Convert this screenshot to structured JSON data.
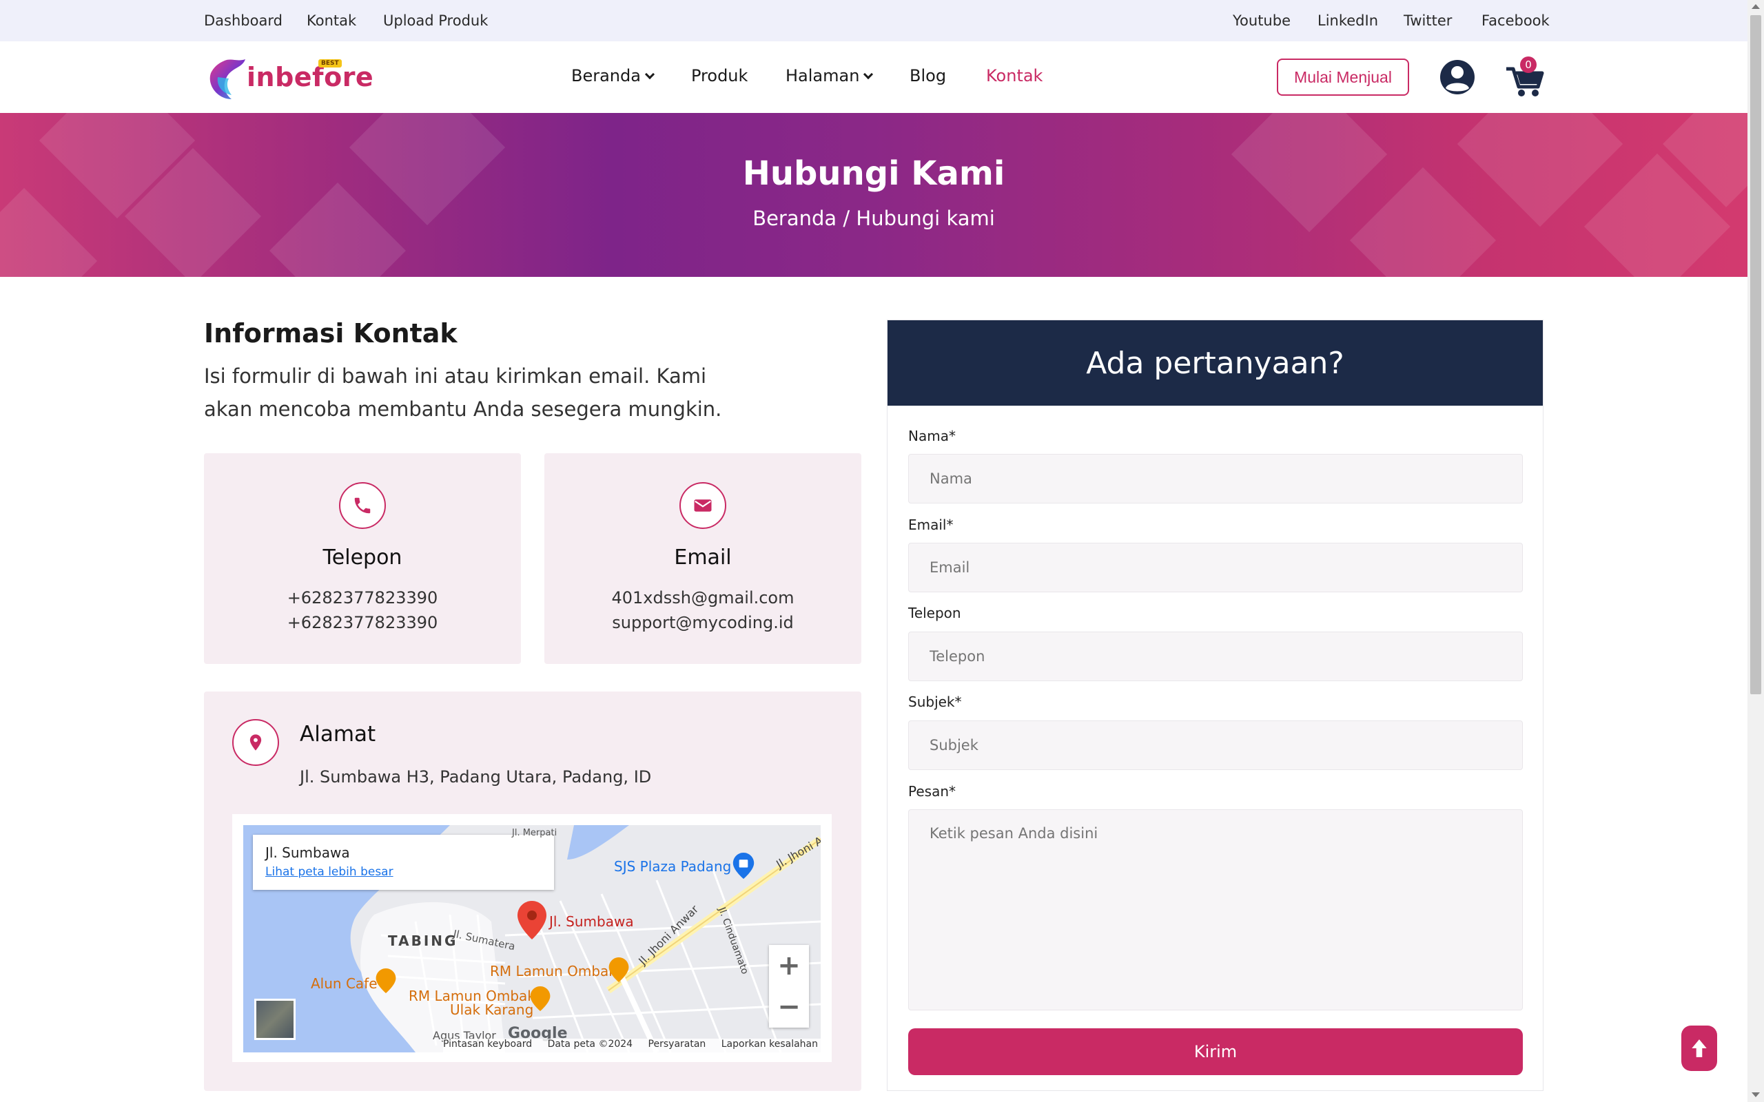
{
  "topbar": {
    "left_links": [
      "Dashboard",
      "Kontak",
      "Upload Produk"
    ],
    "right_links": [
      "Youtube",
      "LinkedIn",
      "Twitter",
      "Facebook"
    ]
  },
  "header": {
    "logo_text": "inbefore",
    "logo_badge": "BEST",
    "nav": {
      "beranda": "Beranda",
      "produk": "Produk",
      "halaman": "Halaman",
      "blog": "Blog",
      "kontak": "Kontak"
    },
    "sell_button": "Mulai Menjual",
    "cart_count": "0",
    "accent_color": "#c92a64"
  },
  "banner": {
    "title": "Hubungi Kami",
    "breadcrumb_home": "Beranda",
    "breadcrumb_sep": "/",
    "breadcrumb_current": "Hubungi kami"
  },
  "info": {
    "title": "Informasi Kontak",
    "description": "Isi formulir di bawah ini atau kirimkan email. Kami akan mencoba membantu Anda sesegera mungkin.",
    "phone": {
      "title": "Telepon",
      "lines": [
        "+6282377823390",
        "+6282377823390"
      ]
    },
    "email": {
      "title": "Email",
      "lines": [
        "401xdssh@gmail.com",
        "support@mycoding.id"
      ]
    },
    "address": {
      "title": "Alamat",
      "text": "Jl. Sumbawa H3, Padang Utara, Padang, ID"
    }
  },
  "map": {
    "place_title": "Jl. Sumbawa",
    "place_link": "Lihat peta lebih besar",
    "labels": {
      "pin": "Jl. Sumbawa",
      "plaza": "SJS Plaza Padang",
      "tabing": "TABING",
      "sumatera": "Jl. Sumatera",
      "jhoni": "Jl. Jhoni Anwar",
      "jhoni2": "Jl. Jhoni A",
      "cindua": "Jl. Cinduamato",
      "lamun1": "RM Lamun Ombak",
      "lamun2": "RM Lamun Ombak",
      "ulak": "Ulak Karang",
      "alun": "Alun Cafe",
      "bottom": "Agus Taylor",
      "top": "Jl. Merpati"
    },
    "google": "Google",
    "footer": [
      "Pintasan keyboard",
      "Data peta ©2024",
      "Persyaratan",
      "Laporkan kesalahan peta"
    ],
    "zoom_in": "+",
    "zoom_out": "−"
  },
  "form": {
    "heading": "Ada pertanyaan?",
    "name_label": "Nama*",
    "name_placeholder": "Nama",
    "email_label": "Email*",
    "email_placeholder": "Email",
    "phone_label": "Telepon",
    "phone_placeholder": "Telepon",
    "subject_label": "Subjek*",
    "subject_placeholder": "Subjek",
    "message_label": "Pesan*",
    "message_placeholder": "Ketik pesan Anda disini",
    "submit": "Kirim",
    "heading_color": "#1c2a47"
  }
}
